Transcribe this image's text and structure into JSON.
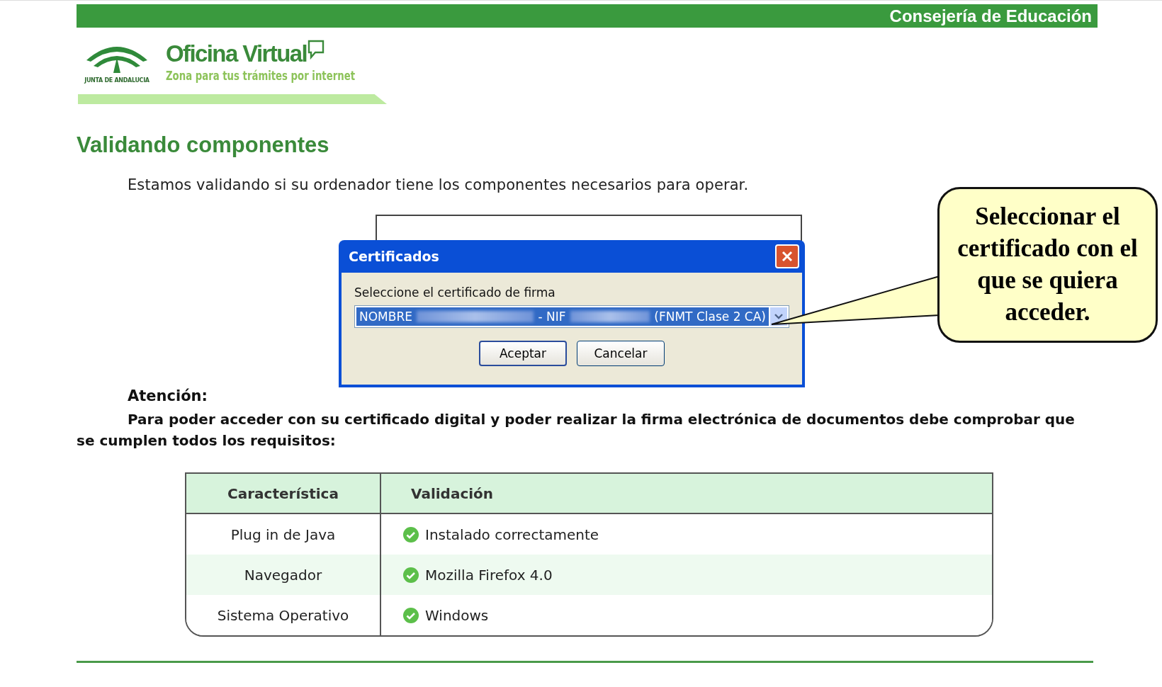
{
  "header": {
    "department": "Consejería de Educación",
    "logo_caption": "JUNTA DE ANDALUCIA",
    "brand_title": "Oficina Virtual",
    "brand_subtitle": "Zona para tus trámites por internet"
  },
  "page_title": "Validando componentes",
  "intro": "Estamos validando si su ordenador tiene los componentes necesarios para operar.",
  "dialog": {
    "title": "Certificados",
    "label": "Seleccione el certificado de firma",
    "selection": [
      {
        "kind": "text",
        "text": "NOMBRE"
      },
      {
        "kind": "redacted"
      },
      {
        "kind": "text",
        "text": "- NIF"
      },
      {
        "kind": "redacted"
      },
      {
        "kind": "text",
        "text": "(FNMT Clase 2 CA)"
      }
    ],
    "buttons": [
      {
        "label": "Aceptar",
        "default": true
      },
      {
        "label": "Cancelar",
        "default": false
      }
    ]
  },
  "callout": "Seleccionar el certificado con el que se quiera acceder.",
  "notice": {
    "title": "Atención:",
    "text": "Para poder acceder con su certificado digital y poder realizar la firma electrónica de documentos debe comprobar que se cumplen todos los requisitos:"
  },
  "table": {
    "columns": [
      "Característica",
      "Validación"
    ],
    "rows": [
      {
        "feature": "Plug in de Java",
        "status": "Instalado correctamente",
        "ok": true
      },
      {
        "feature": "Navegador",
        "status": "Mozilla Firefox 4.0",
        "ok": true
      },
      {
        "feature": "Sistema Operativo",
        "status": "Windows",
        "ok": true
      }
    ]
  }
}
